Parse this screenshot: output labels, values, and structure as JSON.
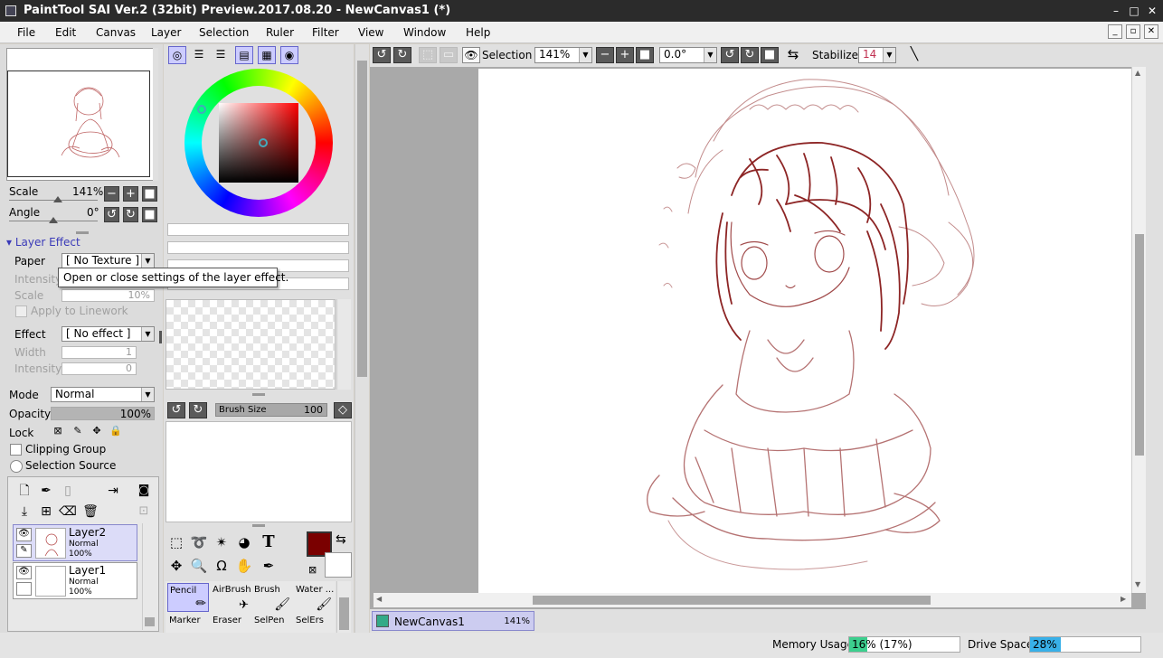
{
  "window": {
    "title": "PaintTool SAI Ver.2 (32bit) Preview.2017.08.20 - NewCanvas1 (*)",
    "minimize": "–",
    "maximize": "□",
    "close": "✕"
  },
  "menu": [
    "File",
    "Edit",
    "Canvas",
    "Layer",
    "Selection",
    "Ruler",
    "Filter",
    "View",
    "Window",
    "Help"
  ],
  "navigator": {
    "scale_label": "Scale",
    "scale_value": "141%",
    "angle_label": "Angle",
    "angle_value": "0°"
  },
  "layer_effect": {
    "header": "Layer Effect",
    "paper_label": "Paper",
    "paper_value": "[ No Texture ]",
    "intensity_label": "Intensity",
    "scale_label": "Scale",
    "scale_value": "10%",
    "apply_linework": "Apply to Linework",
    "effect_label": "Effect",
    "effect_value": "[ No effect ]",
    "width_label": "Width",
    "width_value": "1",
    "intensity2_label": "Intensity",
    "intensity2_value": "0",
    "tooltip": "Open or close settings of the layer effect."
  },
  "layer_props": {
    "mode_label": "Mode",
    "mode_value": "Normal",
    "opacity_label": "Opacity",
    "opacity_value": "100%",
    "opacity_fraction": 1.0,
    "lock_label": "Lock",
    "clipping_group": "Clipping Group",
    "selection_source": "Selection Source"
  },
  "layers": [
    {
      "name": "Layer2",
      "mode": "Normal",
      "opacity": "100%",
      "selected": true
    },
    {
      "name": "Layer1",
      "mode": "Normal",
      "opacity": "100%",
      "selected": false
    }
  ],
  "brush": {
    "size_label": "Brush Size",
    "size_value": "100",
    "main_color": "#7a0000",
    "sub_color": "#ffffff"
  },
  "brush_tools_row1": [
    "Pencil",
    "AirBrush",
    "Brush",
    "Water ..."
  ],
  "brush_tools_row2": [
    "Marker",
    "Eraser",
    "SelPen",
    "SelErs"
  ],
  "canvas_toolbar": {
    "selection_label": "Selection",
    "zoom_value": "141%",
    "angle_value": "0.0°",
    "stabilizer_label": "Stabilizer",
    "stabilizer_value": "14"
  },
  "canvas_tab": {
    "name": "NewCanvas1",
    "zoom": "141%"
  },
  "status": {
    "memory_label": "Memory Usage",
    "memory_value": "16% (17%)",
    "memory_fraction": 0.16,
    "drive_label": "Drive Space",
    "drive_value": "28%",
    "drive_fraction": 0.28
  },
  "colors": {
    "accent": "#3a3ab8",
    "stroke": "#7a0000",
    "memory_fill": "#3ccf8e",
    "drive_fill": "#38b0e8"
  }
}
